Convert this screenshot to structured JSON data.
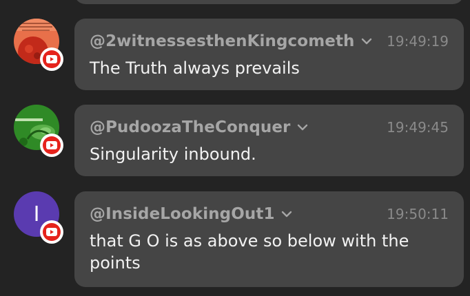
{
  "messages": [
    {
      "handle": "@2witnessesthenKingcometh",
      "time": "19:49:19",
      "text": "The Truth always prevails",
      "avatar_icon": "red-planet-avatar",
      "platform_icon": "youtube-icon"
    },
    {
      "handle": "@PudoozaTheConquer",
      "time": "19:49:45",
      "text": "Singularity inbound.",
      "avatar_icon": "green-dragon-avatar",
      "platform_icon": "youtube-icon"
    },
    {
      "handle": "@InsideLookingOut1",
      "time": "19:50:11",
      "text": "that G O is as above so below with the points",
      "avatar_initial": "I",
      "platform_icon": "youtube-icon"
    }
  ],
  "colors": {
    "background": "#232323",
    "bubble": "#454545",
    "handle": "#a6a6a6",
    "timestamp": "#8a8a8a",
    "message_text": "#f2f2f2",
    "youtube_red": "#e5231c",
    "initial_avatar": "#5a3bb0"
  }
}
